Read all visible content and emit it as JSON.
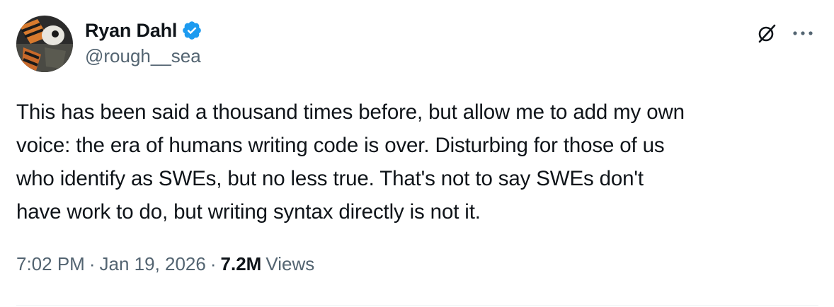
{
  "author": {
    "display_name": "Ryan Dahl",
    "handle": "@rough__sea",
    "verified_color": "#1d9bf0"
  },
  "icons": {
    "avatar": "profile-avatar",
    "verified": "verified-badge-icon",
    "grok": "grok-icon",
    "more": "more-options-icon"
  },
  "tweet": {
    "text": "This has been said a thousand times before, but allow me to add my own\nvoice: the era of humans writing code is over. Disturbing for those of us\nwho identify as SWEs, but no less true. That's not to say SWEs don't\nhave work to do, but writing syntax directly is not it."
  },
  "meta": {
    "time": "7:02 PM",
    "dot1": "·",
    "date": "Jan 19, 2026",
    "dot2": "·",
    "views_count": "7.2M",
    "views_label": "Views"
  },
  "colors": {
    "text_primary": "#0f1419",
    "text_secondary": "#536471",
    "accent": "#1d9bf0",
    "divider": "#eff3f4"
  }
}
